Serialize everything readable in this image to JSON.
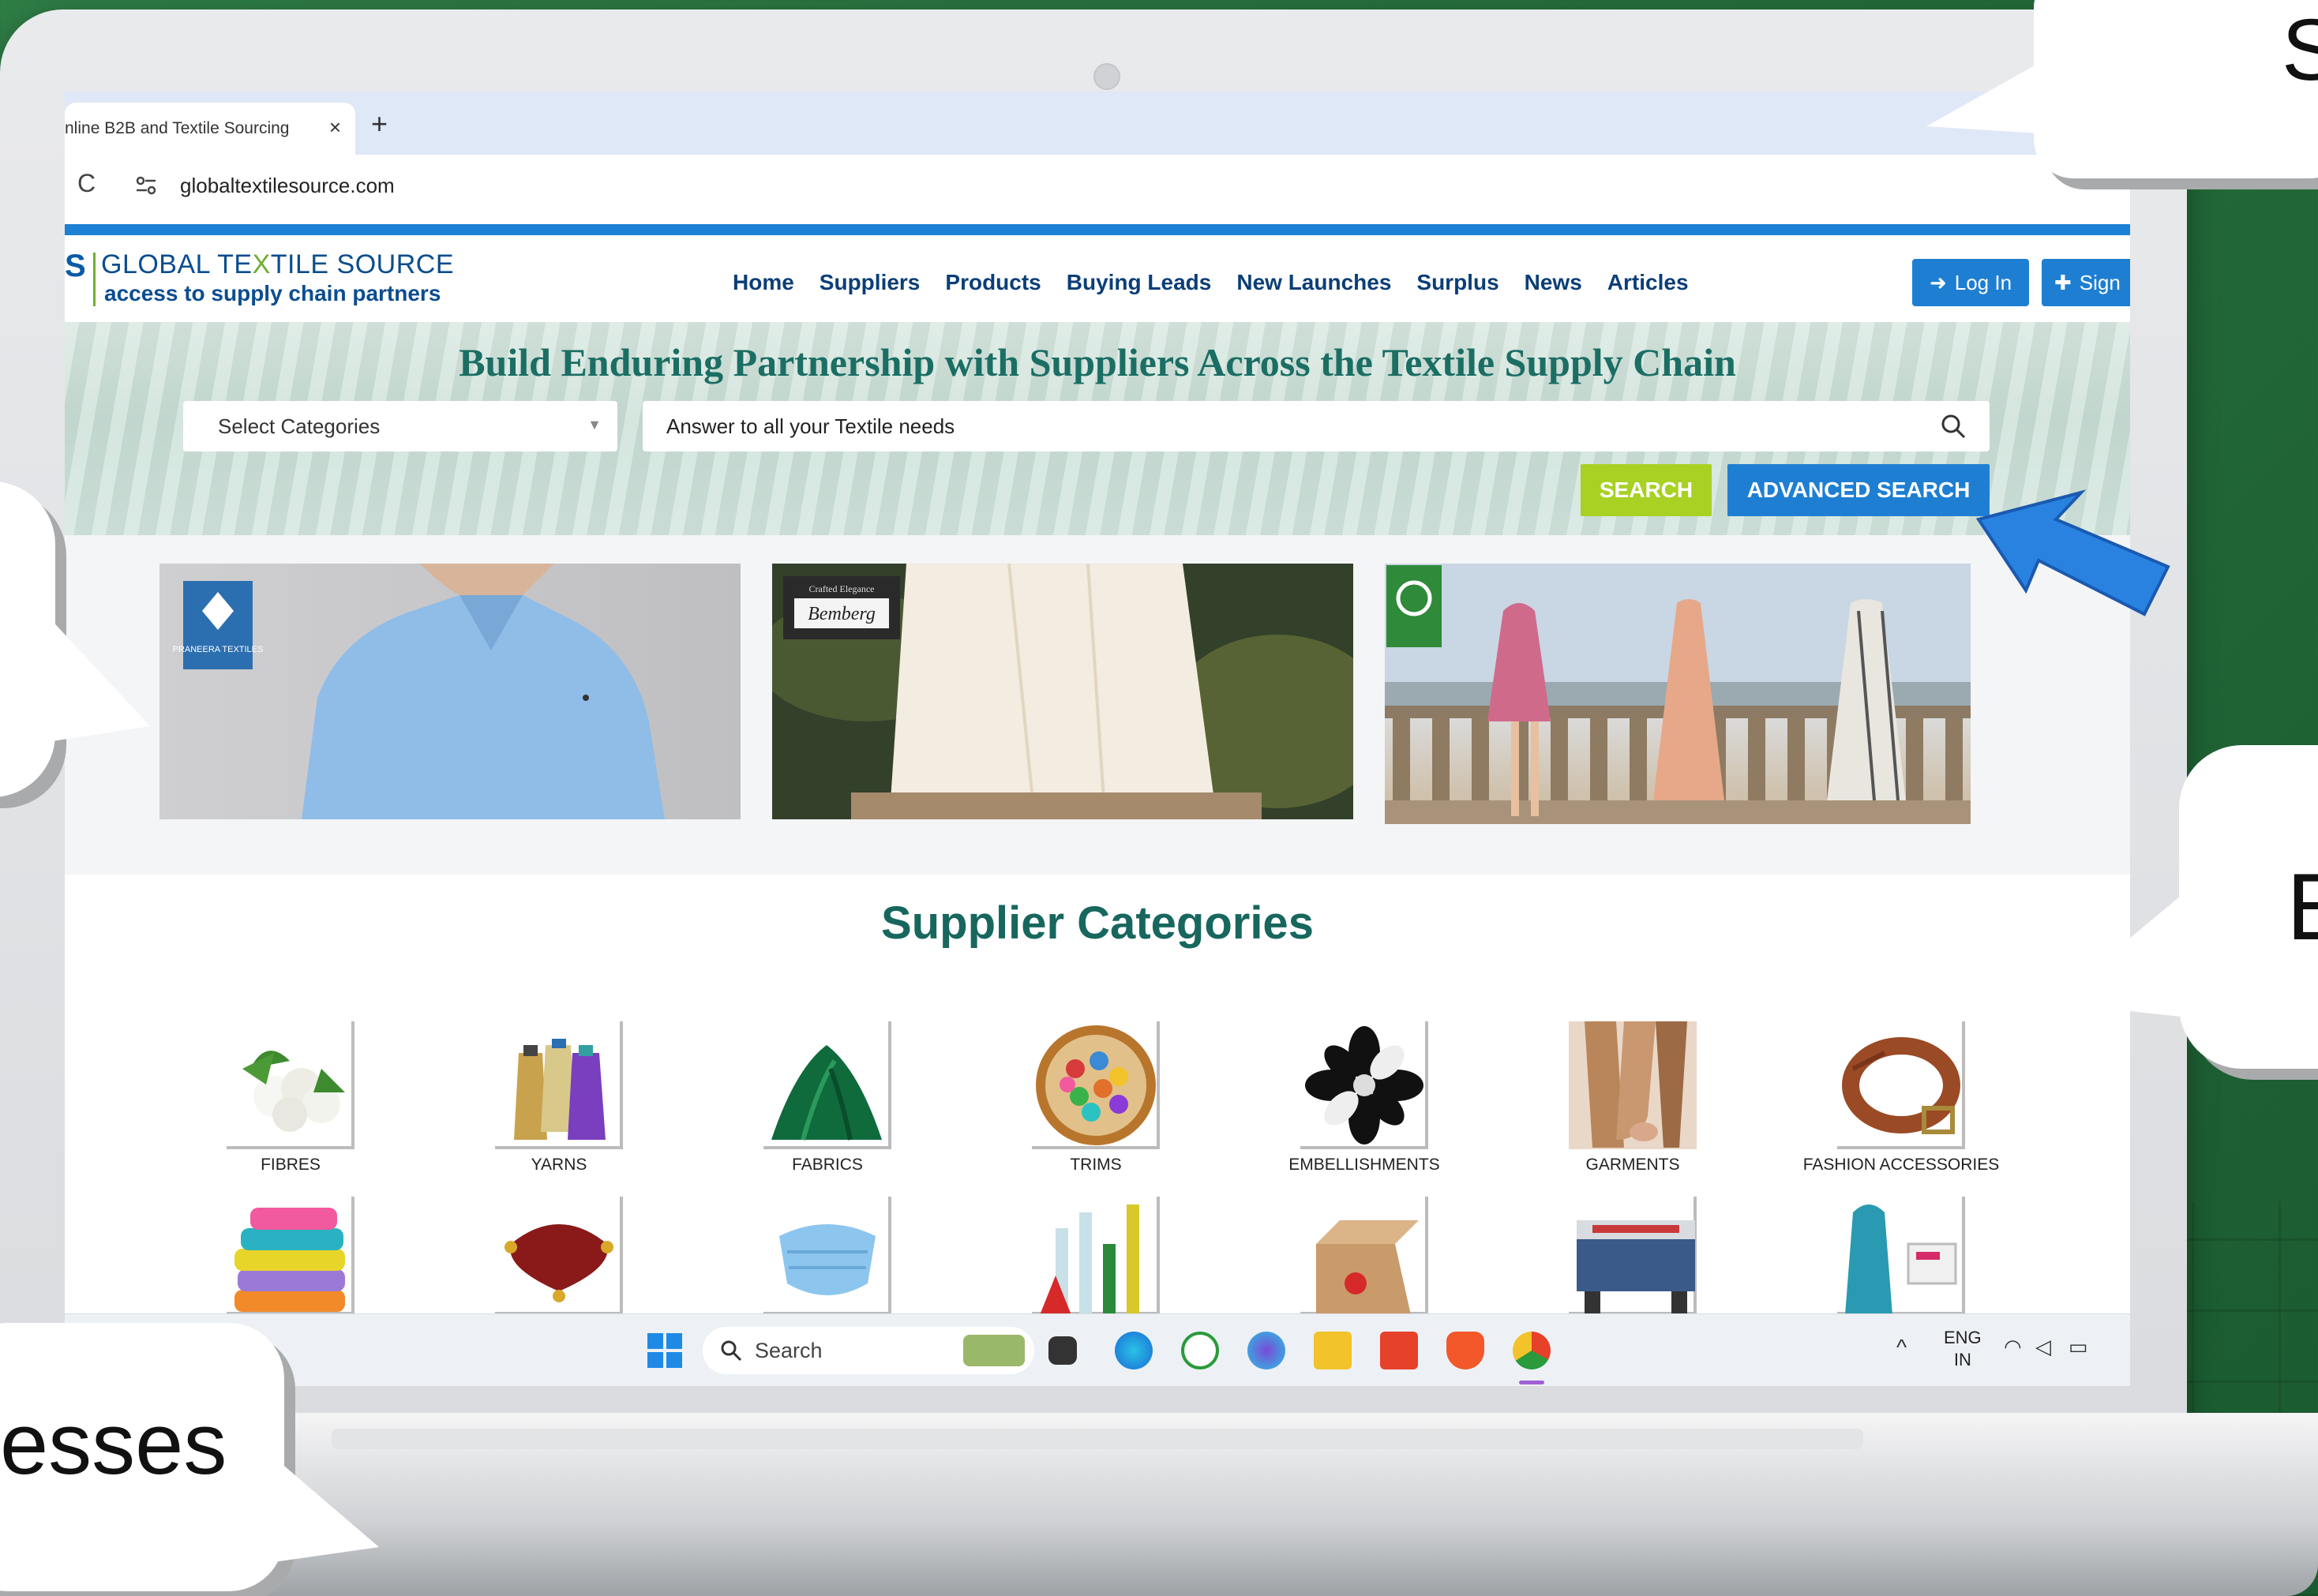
{
  "browser": {
    "tab_title": "nline B2B and Textile Sourcing",
    "close_glyph": "×",
    "new_tab_glyph": "+",
    "reload_glyph": "C",
    "url": "globaltextilesource.com"
  },
  "site": {
    "logo_mark": "S",
    "logo_title_pre": "GLOBAL TE",
    "logo_title_x": "X",
    "logo_title_post": "TILE SOURCE",
    "logo_subtitle": "access to supply chain partners",
    "nav": [
      "Home",
      "Suppliers",
      "Products",
      "Buying Leads",
      "New Launches",
      "Surplus",
      "News",
      "Articles"
    ],
    "login_label": "Log In",
    "signup_label": "Sign",
    "hero_title": "Build Enduring Partnership with Suppliers Across the Textile Supply Chain",
    "category_select": "Select Categories",
    "search_placeholder": "Answer to all your Textile needs",
    "search_button": "SEARCH",
    "advanced_search_button": "ADVANCED SEARCH",
    "banner1_logo": "PRANEERA TEXTILES",
    "banner2_logo_top": "Crafted Elegance",
    "banner2_logo": "Bemberg",
    "categories_title": "Supplier Categories",
    "categories": [
      "FIBRES",
      "YARNS",
      "FABRICS",
      "TRIMS",
      "EMBELLISHMENTS",
      "GARMENTS",
      "FASHION ACCESSORIES"
    ]
  },
  "taskbar": {
    "search_label": "Search",
    "lang": "ENG",
    "region": "IN"
  },
  "callouts": {
    "top_right": "S",
    "right": "E",
    "bottom_left": "esses"
  },
  "colors": {
    "brand_blue": "#1e7fd2",
    "search_green": "#a8d123",
    "hero_text": "#1b6e64",
    "background_green": "#2f7d46"
  }
}
